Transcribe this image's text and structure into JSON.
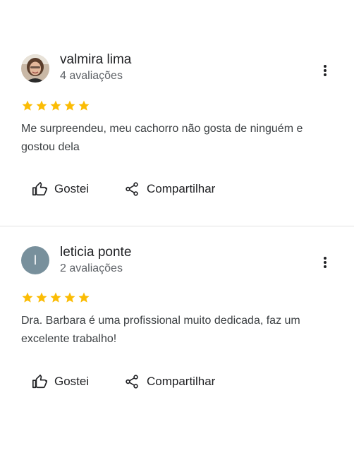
{
  "colors": {
    "star": "#fbbc04",
    "avatar_letter_bg": "#78909c",
    "divider": "#e3e3e3"
  },
  "reviews": [
    {
      "name": "valmira lima",
      "review_count": "4 avaliações",
      "avatar": {
        "type": "photo",
        "letter": ""
      },
      "rating": 5,
      "text": "Me surpreendeu, meu cachorro não gosta de ninguém e gostou dela",
      "like_label": "Gostei",
      "share_label": "Compartilhar"
    },
    {
      "name": "leticia ponte",
      "review_count": "2 avaliações",
      "avatar": {
        "type": "letter",
        "letter": "l"
      },
      "rating": 5,
      "text": "Dra. Barbara é uma profissional muito dedicada, faz um excelente trabalho!",
      "like_label": "Gostei",
      "share_label": "Compartilhar"
    }
  ],
  "icons": {
    "more": "more-vert-icon",
    "like": "thumb-up-icon",
    "share": "share-icon",
    "star": "star-icon"
  }
}
